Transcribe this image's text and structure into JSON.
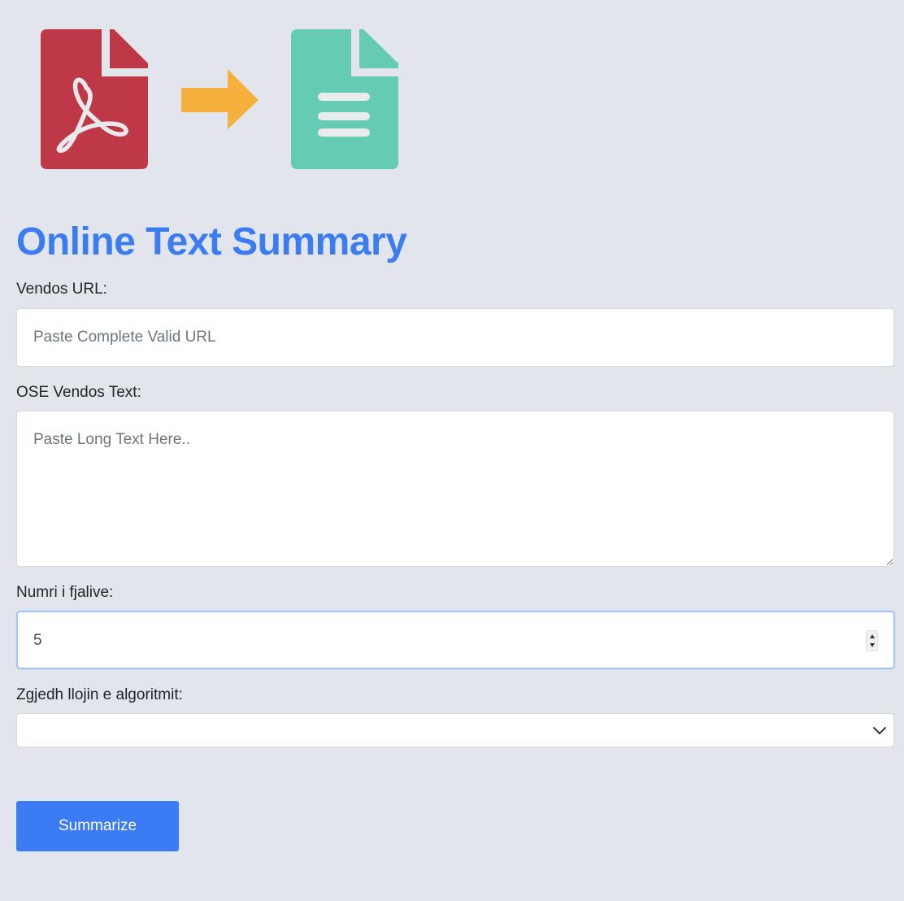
{
  "header": {
    "title": "Online Text Summary",
    "graphic": {
      "source_icon": "pdf-file-icon",
      "arrow_icon": "arrow-right-icon",
      "target_icon": "text-document-icon",
      "colors": {
        "pdf": "#bf3847",
        "arrow": "#f5b03e",
        "document": "#66cbb3"
      }
    }
  },
  "form": {
    "url": {
      "label": "Vendos URL:",
      "value": "",
      "placeholder": "Paste Complete Valid URL"
    },
    "text": {
      "label": "OSE Vendos Text:",
      "value": "",
      "placeholder": "Paste Long Text Here.."
    },
    "sentences": {
      "label": "Numri i fjalive:",
      "value": "5"
    },
    "algorithm": {
      "label": "Zgjedh llojin e algoritmit:",
      "selected": ""
    },
    "submit_label": "Summarize"
  },
  "colors": {
    "accent": "#3b7cf0",
    "background": "#e2e6ec"
  }
}
